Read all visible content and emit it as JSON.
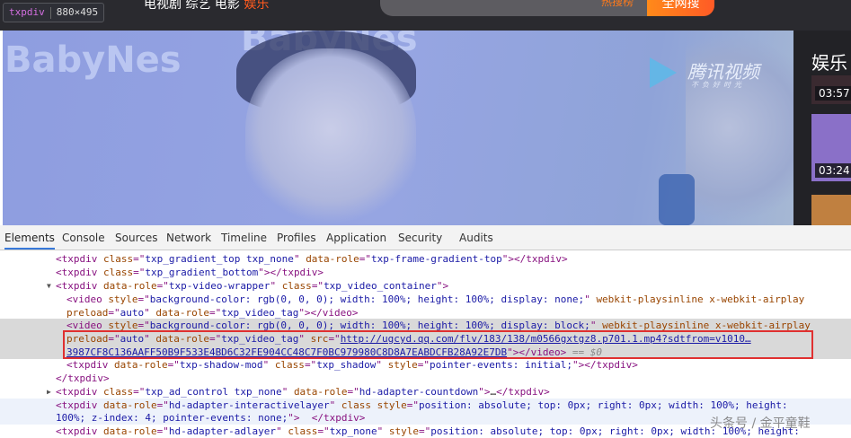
{
  "topbar": {
    "nav_text": "电视剧  综艺  电影  ",
    "nav_active": "娱乐",
    "hot_list": "热搜榜",
    "search_button": "全网搜"
  },
  "tooltip": {
    "tag": "txpdiv",
    "size": "880×495"
  },
  "video": {
    "brand": "BabyNes",
    "logo_name": "腾讯视频",
    "logo_slogan": "不负好时光"
  },
  "sidebar": {
    "title": "娱乐",
    "items": [
      {
        "duration": "03:57"
      },
      {
        "duration": "03:24"
      }
    ]
  },
  "devtools": {
    "tabs": [
      "Elements",
      "Console",
      "Sources",
      "Network",
      "Timeline",
      "Profiles",
      "Application",
      "Security",
      "Audits"
    ],
    "active_tab": "Elements",
    "lines": [
      {
        "indent": 62,
        "tokens": [
          [
            "tag",
            "<txpdiv "
          ],
          [
            "attr",
            "class"
          ],
          [
            "tag",
            "=\""
          ],
          [
            "val",
            "txp_gradient_top txp_none"
          ],
          [
            "tag",
            "\" "
          ],
          [
            "attr",
            "data-role"
          ],
          [
            "tag",
            "=\""
          ],
          [
            "val",
            "txp-frame-gradient-top"
          ],
          [
            "tag",
            "\"></txpdiv>"
          ]
        ]
      },
      {
        "indent": 62,
        "tokens": [
          [
            "tag",
            "<txpdiv "
          ],
          [
            "attr",
            "class"
          ],
          [
            "tag",
            "=\""
          ],
          [
            "val",
            "txp_gradient_bottom"
          ],
          [
            "tag",
            "\"></txpdiv>"
          ]
        ]
      },
      {
        "indent": 62,
        "arrow": "down",
        "tokens": [
          [
            "tag",
            "<txpdiv "
          ],
          [
            "attr",
            "data-role"
          ],
          [
            "tag",
            "=\""
          ],
          [
            "val",
            "txp-video-wrapper"
          ],
          [
            "tag",
            "\" "
          ],
          [
            "attr",
            "class"
          ],
          [
            "tag",
            "=\""
          ],
          [
            "val",
            "txp_video_container"
          ],
          [
            "tag",
            "\">"
          ]
        ]
      },
      {
        "indent": 74,
        "tokens": [
          [
            "tag",
            "<video "
          ],
          [
            "attr",
            "style"
          ],
          [
            "tag",
            "=\""
          ],
          [
            "val",
            "background-color: rgb(0, 0, 0); width: 100%; height: 100%; display: none;"
          ],
          [
            "tag",
            "\" "
          ],
          [
            "attr",
            "webkit-playsinline x-webkit-airplay"
          ]
        ]
      },
      {
        "indent": 74,
        "tokens": [
          [
            "attr",
            "preload"
          ],
          [
            "tag",
            "=\""
          ],
          [
            "val",
            "auto"
          ],
          [
            "tag",
            "\" "
          ],
          [
            "attr",
            "data-role"
          ],
          [
            "tag",
            "=\""
          ],
          [
            "val",
            "txp_video_tag"
          ],
          [
            "tag",
            "\"></video>"
          ]
        ]
      },
      {
        "indent": 74,
        "state": "sel",
        "tokens": [
          [
            "tag",
            "<video "
          ],
          [
            "attr",
            "style"
          ],
          [
            "tag",
            "=\""
          ],
          [
            "val",
            "background-color: rgb(0, 0, 0); width: 100%; height: 100%; display: block;"
          ],
          [
            "tag",
            "\" "
          ],
          [
            "attr",
            "webkit-playsinline x-webkit-airplay"
          ]
        ]
      },
      {
        "indent": 74,
        "state": "sel",
        "tokens": [
          [
            "attr",
            "preload"
          ],
          [
            "tag",
            "=\""
          ],
          [
            "val",
            "auto"
          ],
          [
            "tag",
            "\" "
          ],
          [
            "attr",
            "data-role"
          ],
          [
            "tag",
            "=\""
          ],
          [
            "val",
            "txp_video_tag"
          ],
          [
            "tag",
            "\" "
          ],
          [
            "attr",
            "src"
          ],
          [
            "tag",
            "=\""
          ],
          [
            "link",
            "http://ugcyd.qq.com/flv/183/138/m0566gxtgz8.p701.1.mp4?sdtfrom=v1010…"
          ]
        ]
      },
      {
        "indent": 74,
        "state": "sel",
        "tokens": [
          [
            "link",
            "3987CF8C136AAFF50B9F533E4BD6C32FE904CC48C7F0BC979980C8D8A7EABDCFB28A92E7DB"
          ],
          [
            "tag",
            "\"></video>"
          ],
          [
            "dollar",
            " == $0"
          ]
        ]
      },
      {
        "indent": 74,
        "tokens": [
          [
            "tag",
            "<txpdiv "
          ],
          [
            "attr",
            "data-role"
          ],
          [
            "tag",
            "=\""
          ],
          [
            "val",
            "txp-shadow-mod"
          ],
          [
            "tag",
            "\" "
          ],
          [
            "attr",
            "class"
          ],
          [
            "tag",
            "=\""
          ],
          [
            "val",
            "txp_shadow"
          ],
          [
            "tag",
            "\" "
          ],
          [
            "attr",
            "style"
          ],
          [
            "tag",
            "=\""
          ],
          [
            "val",
            "pointer-events: initial;"
          ],
          [
            "tag",
            "\"></txpdiv>"
          ]
        ]
      },
      {
        "indent": 62,
        "tokens": [
          [
            "tag",
            "</txpdiv>"
          ]
        ]
      },
      {
        "indent": 62,
        "arrow": "right",
        "tokens": [
          [
            "tag",
            "<txpdiv "
          ],
          [
            "attr",
            "class"
          ],
          [
            "tag",
            "=\""
          ],
          [
            "val",
            "txp_ad_control txp_none"
          ],
          [
            "tag",
            "\" "
          ],
          [
            "attr",
            "data-role"
          ],
          [
            "tag",
            "=\""
          ],
          [
            "val",
            "hd-adapter-countdown"
          ],
          [
            "tag",
            "\">"
          ],
          [
            "text",
            "…"
          ],
          [
            "tag",
            "</txpdiv>"
          ]
        ]
      },
      {
        "indent": 62,
        "state": "hov",
        "tokens": [
          [
            "tag",
            "<txpdiv "
          ],
          [
            "attr",
            "data-role"
          ],
          [
            "tag",
            "=\""
          ],
          [
            "val",
            "hd-adapter-interactivelayer"
          ],
          [
            "tag",
            "\" "
          ],
          [
            "attr",
            "class style"
          ],
          [
            "tag",
            "=\""
          ],
          [
            "val",
            "position: absolute; top: 0px; right: 0px; width: 100%; height:"
          ]
        ]
      },
      {
        "indent": 62,
        "state": "hov",
        "tokens": [
          [
            "val",
            "100%; z-index: 4; pointer-events: none;"
          ],
          [
            "tag",
            "\">  </txpdiv>"
          ]
        ]
      },
      {
        "indent": 62,
        "tokens": [
          [
            "tag",
            "<txpdiv "
          ],
          [
            "attr",
            "data-role"
          ],
          [
            "tag",
            "=\""
          ],
          [
            "val",
            "hd-adapter-adlayer"
          ],
          [
            "tag",
            "\" "
          ],
          [
            "attr",
            "class"
          ],
          [
            "tag",
            "=\""
          ],
          [
            "val",
            "txp_none"
          ],
          [
            "tag",
            "\" "
          ],
          [
            "attr",
            "style"
          ],
          [
            "tag",
            "=\""
          ],
          [
            "val",
            "position: absolute; top: 0px; right: 0px; width: 100%; height:"
          ]
        ]
      }
    ]
  },
  "watermark": "头条号 / 金平童鞋",
  "colors": {
    "accent": "#ff6a1f",
    "tab_active": "#3879d9",
    "highlight_box": "#e03030"
  }
}
